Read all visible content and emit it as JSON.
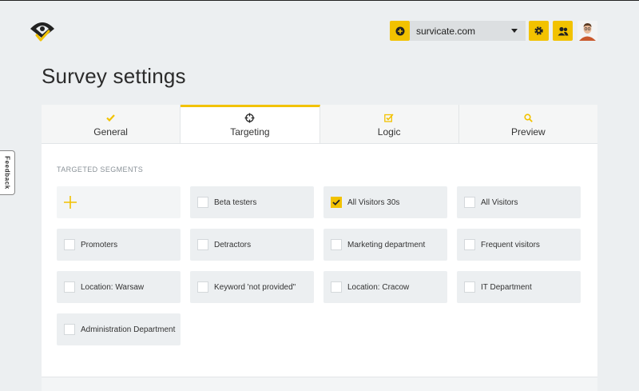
{
  "header": {
    "site_name": "survicate.com",
    "brand_color": "#f2c200"
  },
  "page": {
    "title": "Survey settings"
  },
  "feedback_tab": {
    "label": "Feedback"
  },
  "tabs": [
    {
      "label": "General",
      "icon": "check-icon"
    },
    {
      "label": "Targeting",
      "icon": "crosshair-icon",
      "active": true
    },
    {
      "label": "Logic",
      "icon": "checkbox-icon"
    },
    {
      "label": "Preview",
      "icon": "search-icon"
    }
  ],
  "targeting": {
    "section_label": "TARGETED SEGMENTS",
    "segments": [
      {
        "label": "Beta testers",
        "checked": false
      },
      {
        "label": "All Visitors 30s",
        "checked": true
      },
      {
        "label": "All Visitors",
        "checked": false
      },
      {
        "label": "Promoters",
        "checked": false
      },
      {
        "label": "Detractors",
        "checked": false
      },
      {
        "label": "Marketing department",
        "checked": false
      },
      {
        "label": "Frequent visitors",
        "checked": false
      },
      {
        "label": "Location: Warsaw",
        "checked": false
      },
      {
        "label": "Keyword 'not provided\"",
        "checked": false
      },
      {
        "label": "Location: Cracow",
        "checked": false
      },
      {
        "label": "IT Department",
        "checked": false
      },
      {
        "label": "Administration Department",
        "checked": false
      }
    ]
  }
}
